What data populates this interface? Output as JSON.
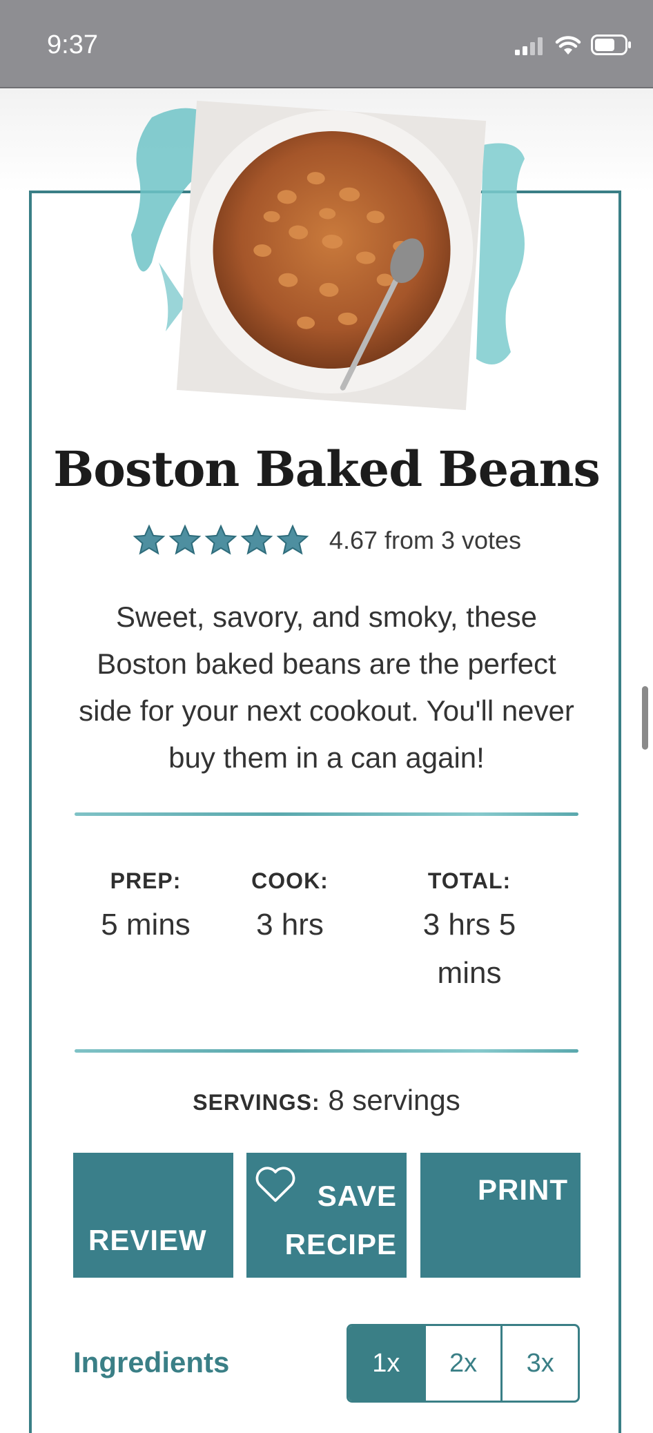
{
  "status_bar": {
    "time": "9:37"
  },
  "recipe": {
    "title": "Boston Baked Beans",
    "rating": {
      "value": 4.67,
      "text": "4.67 from 3 votes",
      "stars": 5
    },
    "summary": "Sweet, savory, and smoky, these Boston baked beans are the perfect side for your next cookout. You'll never buy them in a can again!",
    "times": [
      {
        "label": "PREP:",
        "value": "5 mins"
      },
      {
        "label": "COOK:",
        "value": "3 hrs"
      },
      {
        "label": "TOTAL:",
        "value": "3 hrs 5 mins"
      }
    ],
    "servings": {
      "label": "SERVINGS:",
      "value": "8 servings"
    },
    "actions": {
      "review": "REVIEW",
      "save": "SAVE RECIPE",
      "print": "PRINT"
    },
    "ingredients_title": "Ingredients",
    "scale_options": [
      "1x",
      "2x",
      "3x"
    ],
    "scale_selected": "1x"
  },
  "colors": {
    "accent": "#3a7f86",
    "button": "#3a7f8a",
    "status_bar": "#8e8e92"
  }
}
